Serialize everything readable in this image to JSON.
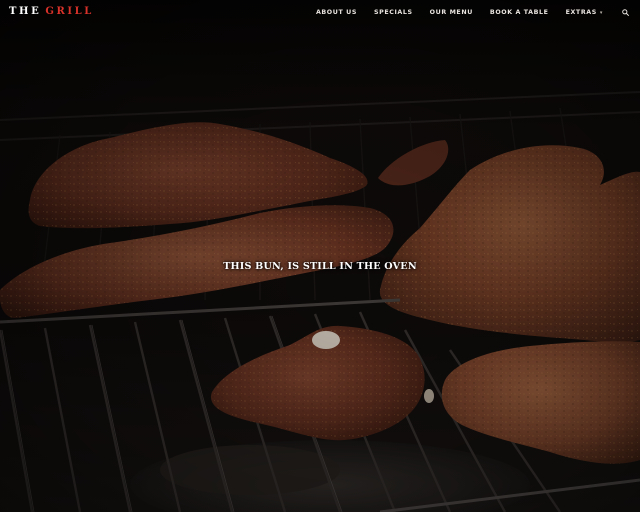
{
  "brand": {
    "part1": "THE",
    "part2": "GRILL",
    "part1_color": "#ffffff",
    "part2_color": "#d8322a"
  },
  "nav": {
    "items": [
      {
        "label": "ABOUT US"
      },
      {
        "label": "SPECIALS"
      },
      {
        "label": "OUR MENU"
      },
      {
        "label": "BOOK A TABLE"
      },
      {
        "label": "EXTRAS",
        "has_dropdown": true
      }
    ],
    "search_icon": "search-icon"
  },
  "hero": {
    "caption": "THIS BUN, IS STILL IN THE OVEN",
    "background": "grilled meat on a barbecue grill"
  }
}
